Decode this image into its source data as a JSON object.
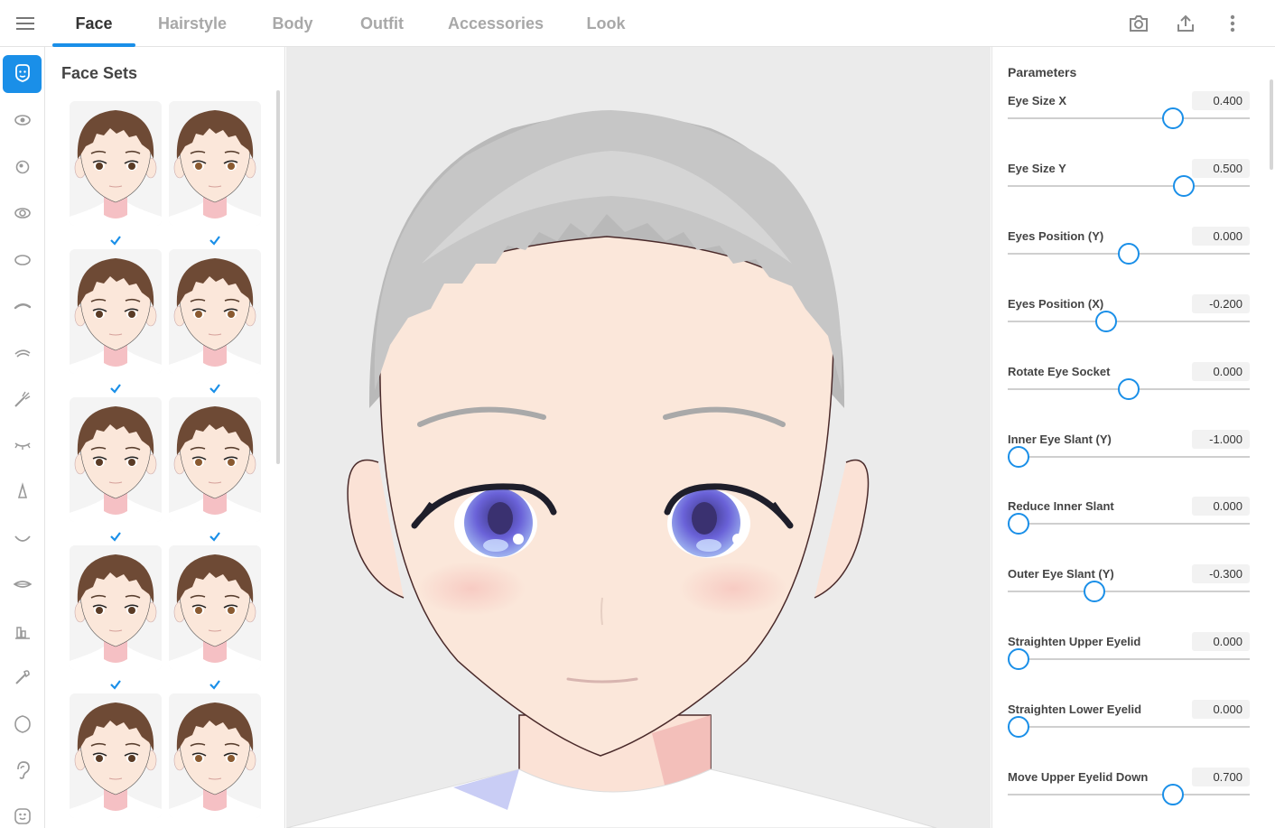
{
  "header": {
    "tabs": [
      {
        "label": "Face",
        "active": true
      },
      {
        "label": "Hairstyle",
        "active": false
      },
      {
        "label": "Body",
        "active": false
      },
      {
        "label": "Outfit",
        "active": false
      },
      {
        "label": "Accessories",
        "active": false
      },
      {
        "label": "Look",
        "active": false
      }
    ],
    "actions": [
      "camera-icon",
      "share-icon",
      "more-vert-icon"
    ]
  },
  "rail": {
    "items": [
      "face-shape-icon",
      "eye-icon",
      "iris-icon",
      "eye-outline-icon",
      "eye-oval-icon",
      "eyebrow-icon",
      "eyelash-icon",
      "eyelash-brush-icon",
      "lashes-down-icon",
      "nose-icon",
      "mouth-icon",
      "lips-icon",
      "teeth-icon",
      "makeup-brush-icon",
      "face-contour-icon",
      "ear-icon",
      "expression-icon"
    ],
    "active_index": 0
  },
  "facesets": {
    "title": "Face Sets",
    "count": 10
  },
  "params": {
    "title": "Parameters",
    "items": [
      {
        "label": "Eye Size X",
        "value": "0.400",
        "fraction": 0.682
      },
      {
        "label": "Eye Size Y",
        "value": "0.500",
        "fraction": 0.728
      },
      {
        "label": "Eyes Position (Y)",
        "value": "0.000",
        "fraction": 0.5
      },
      {
        "label": "Eyes Position (X)",
        "value": "-0.200",
        "fraction": 0.408
      },
      {
        "label": "Rotate Eye Socket",
        "value": "0.000",
        "fraction": 0.5
      },
      {
        "label": "Inner Eye Slant (Y)",
        "value": "-1.000",
        "fraction": 0.045
      },
      {
        "label": "Reduce Inner Slant",
        "value": "0.000",
        "fraction": 0.045
      },
      {
        "label": "Outer Eye Slant (Y)",
        "value": "-0.300",
        "fraction": 0.36
      },
      {
        "label": "Straighten Upper Eyelid",
        "value": "0.000",
        "fraction": 0.045
      },
      {
        "label": "Straighten Lower Eyelid",
        "value": "0.000",
        "fraction": 0.045
      },
      {
        "label": "Move Upper Eyelid Down",
        "value": "0.700",
        "fraction": 0.682
      }
    ]
  },
  "colors": {
    "accent": "#1a8fe8",
    "skin": "#fbe7da",
    "hair_preview": "#c8c8c8",
    "thumb_hair": "#6e4a35",
    "iris": "#6a6ad8"
  }
}
